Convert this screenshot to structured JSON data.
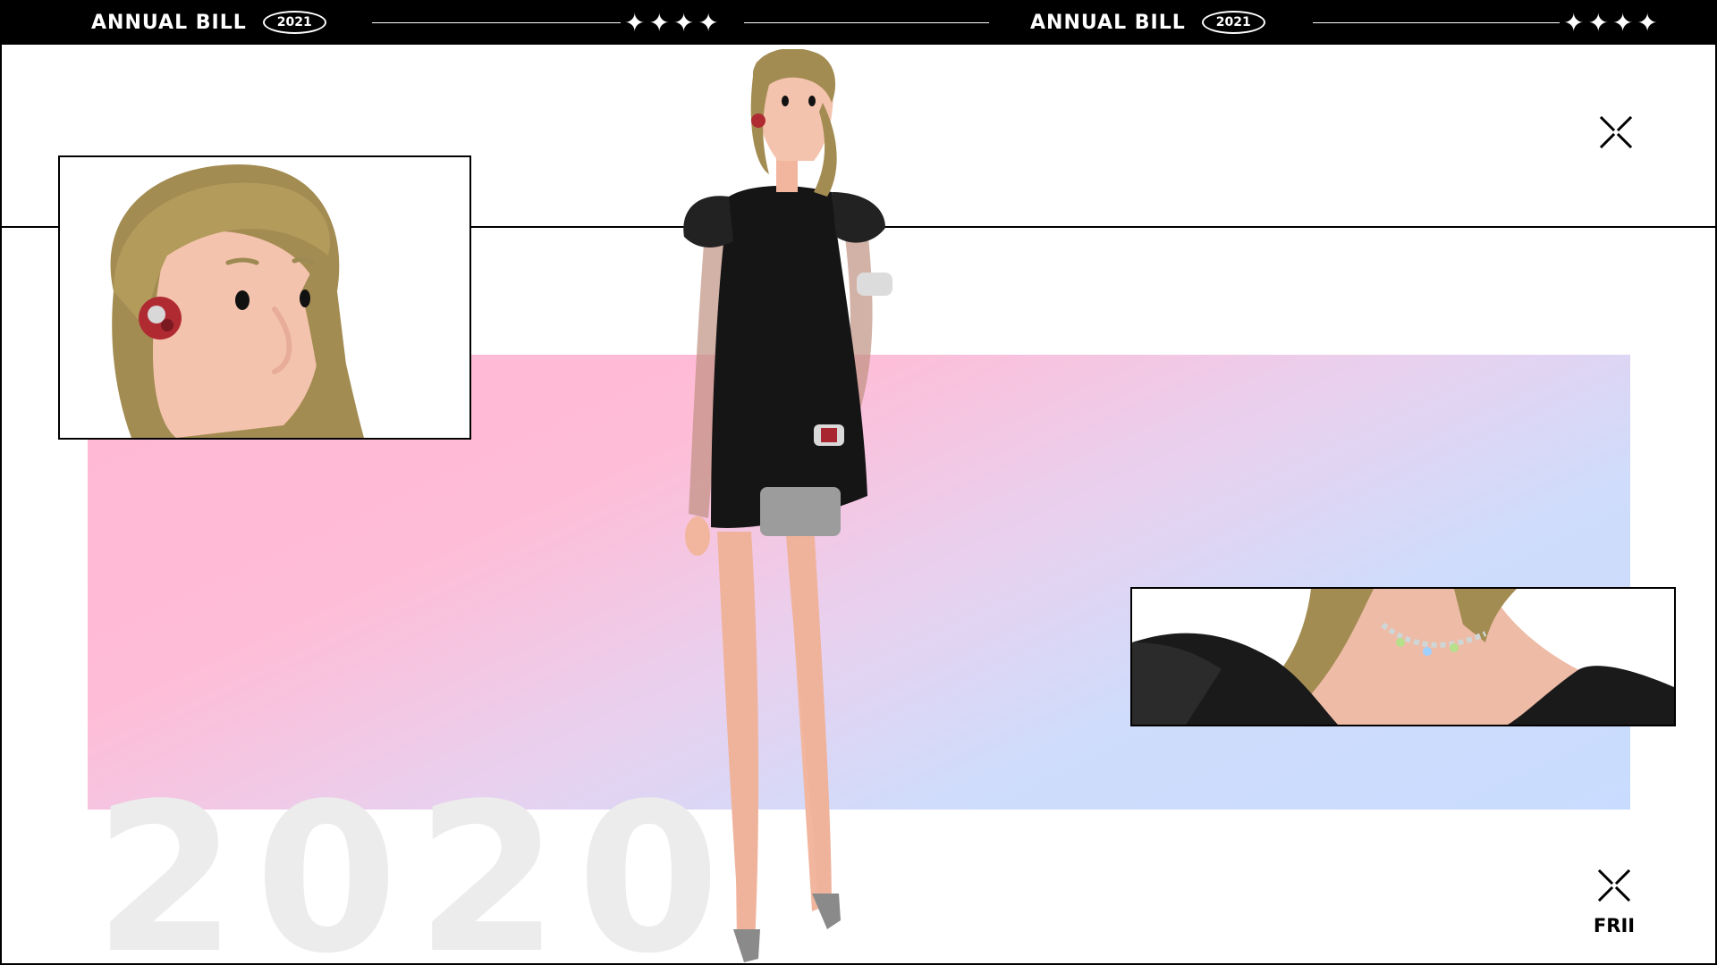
{
  "banner": {
    "left": {
      "title": "ANNUAL BILL",
      "year": "2021",
      "stars": "✦✦✦✦"
    },
    "right": {
      "title": "ANNUAL BILL",
      "year": "2021",
      "stars": "✦✦✦✦"
    }
  },
  "watermark_year": "2020",
  "brand": {
    "label": "FRII"
  },
  "icons": {
    "top_right": "close-x-icon",
    "bottom_right": "close-x-icon"
  },
  "colors": {
    "banner_bg": "#000000",
    "gradient_pink": "#ffb8d4",
    "gradient_blue": "#c9dcff",
    "watermark": "#ececec"
  }
}
